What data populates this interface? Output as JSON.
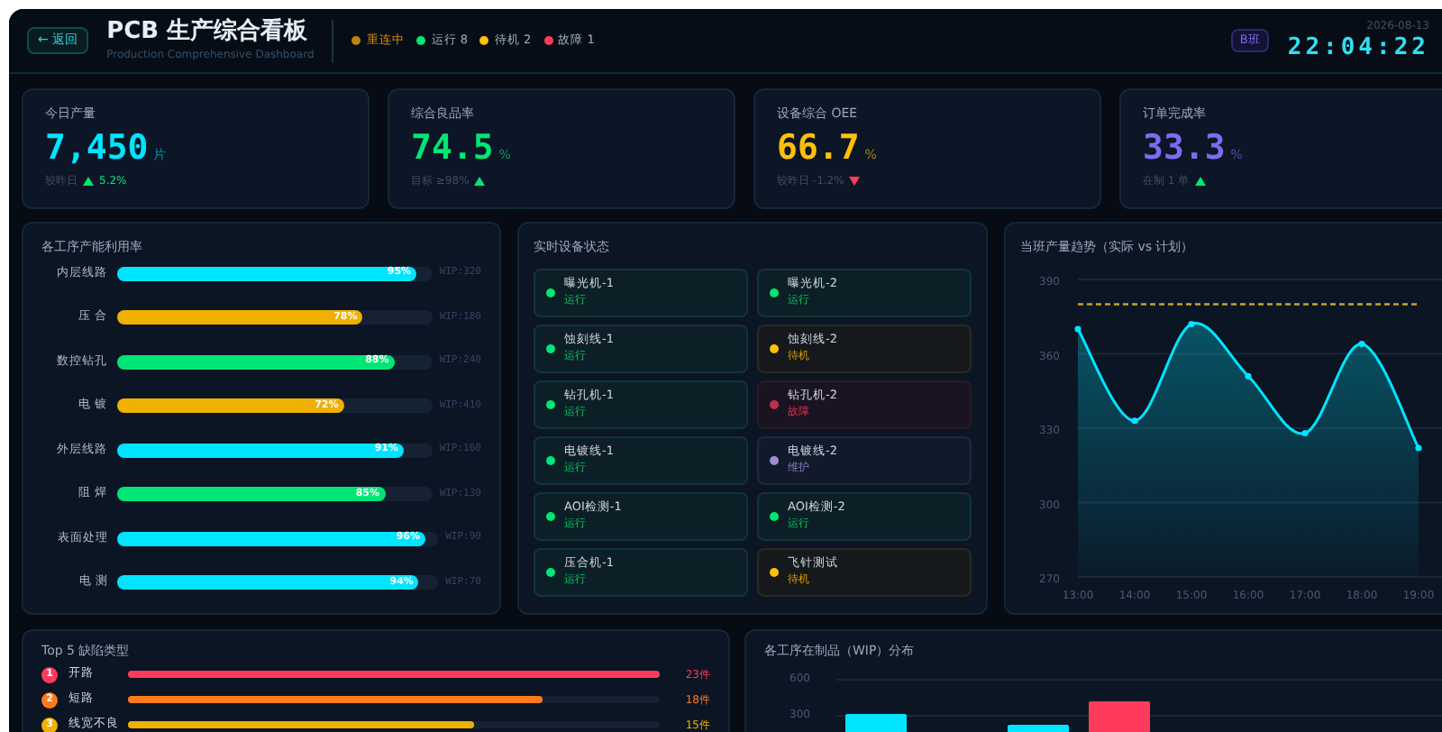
{
  "header": {
    "back": "← 返回",
    "title": "PCB 生产综合看板",
    "subtitle": "Production Comprehensive Dashboard",
    "statuses": [
      {
        "label": "重连中",
        "color": "#b8860b",
        "kind": "connection"
      },
      {
        "label": "运行 8",
        "color": "#00e676",
        "kind": "count"
      },
      {
        "label": "待机 2",
        "color": "#ffc107",
        "kind": "count"
      },
      {
        "label": "故障 1",
        "color": "#ff3b5c",
        "kind": "count"
      }
    ],
    "shift": "B班",
    "date": "2026-08-13",
    "time": "22:04:22"
  },
  "kpis": [
    {
      "label": "今日产量",
      "value": "7,450",
      "unit": "片",
      "color": "#00e5ff",
      "note": "较昨日",
      "trend_up": true,
      "change": "5.2%"
    },
    {
      "label": "综合良品率",
      "value": "74.5",
      "unit": "%",
      "color": "#00e676",
      "note": "目标 ≥98%",
      "trend_up": true
    },
    {
      "label": "设备综合 OEE",
      "value": "66.7",
      "unit": "%",
      "color": "#ffc107",
      "note": "较昨日 -1.2%",
      "trend_up": false
    },
    {
      "label": "订单完成率",
      "value": "33.3",
      "unit": "%",
      "color": "#7c6cf0",
      "note": "在制 1 单",
      "trend_up": true
    }
  ],
  "utilization": {
    "title": "各工序产能利用率",
    "rows": [
      {
        "name": "内层线路",
        "level": 0.95,
        "pct": "95%",
        "wip": "WIP:320",
        "color": "#00e5ff"
      },
      {
        "name": "压 合",
        "level": 0.78,
        "pct": "78%",
        "wip": "WIP:180",
        "color": "#f0b000"
      },
      {
        "name": "数控钻孔",
        "level": 0.88,
        "pct": "88%",
        "wip": "WIP:240",
        "color": "#00e676"
      },
      {
        "name": "电 镀",
        "level": 0.72,
        "pct": "72%",
        "wip": "WIP:410",
        "color": "#f0b000"
      },
      {
        "name": "外层线路",
        "level": 0.91,
        "pct": "91%",
        "wip": "WIP:160",
        "color": "#00e5ff"
      },
      {
        "name": "阻 焊",
        "level": 0.85,
        "pct": "85%",
        "wip": "WIP:130",
        "color": "#00e676"
      },
      {
        "name": "表面处理",
        "level": 0.96,
        "pct": "96%",
        "wip": "WIP:90",
        "color": "#00e5ff"
      },
      {
        "name": "电 测",
        "level": 0.94,
        "pct": "94%",
        "wip": "WIP:70",
        "color": "#00e5ff"
      }
    ]
  },
  "equipment": {
    "title": "实时设备状态",
    "items": [
      {
        "name": "曝光机-1",
        "status": "运行",
        "kind": "running"
      },
      {
        "name": "曝光机-2",
        "status": "运行",
        "kind": "running"
      },
      {
        "name": "蚀刻线-1",
        "status": "运行",
        "kind": "running"
      },
      {
        "name": "蚀刻线-2",
        "status": "待机",
        "kind": "idle"
      },
      {
        "name": "钻孔机-1",
        "status": "运行",
        "kind": "running"
      },
      {
        "name": "钻孔机-2",
        "status": "故障",
        "kind": "fault"
      },
      {
        "name": "电镀线-1",
        "status": "运行",
        "kind": "running"
      },
      {
        "name": "电镀线-2",
        "status": "维护",
        "kind": "maintenance"
      },
      {
        "name": "AOI检测-1",
        "status": "运行",
        "kind": "running"
      },
      {
        "name": "AOI检测-2",
        "status": "运行",
        "kind": "running"
      },
      {
        "name": "压合机-1",
        "status": "运行",
        "kind": "running"
      },
      {
        "name": "飞针测试",
        "status": "待机",
        "kind": "idle"
      }
    ]
  },
  "trend": {
    "title": "当班产量趋势（实际 vs 计划）",
    "chart_data": {
      "type": "area",
      "categories": [
        "13:00",
        "14:00",
        "15:00",
        "16:00",
        "17:00",
        "18:00",
        "19:00"
      ],
      "series": [
        {
          "color": "#00e5ff",
          "values": [
            370,
            333,
            372,
            351,
            328,
            364,
            322
          ]
        },
        {
          "type": "line",
          "line_style": "dashed",
          "color": "#c9a227",
          "values": [
            380,
            380,
            380,
            380,
            380,
            380,
            380
          ]
        }
      ],
      "grid": true,
      "ylim": [
        270,
        390
      ],
      "yticks": [
        270,
        300,
        330,
        360,
        390
      ]
    }
  },
  "defects": {
    "title": "Top 5 缺陷类型",
    "items": [
      {
        "rank": "1",
        "name": "开路",
        "level": 1,
        "count": "23件",
        "color": "#ff3b5c"
      },
      {
        "rank": "2",
        "name": "短路",
        "level": 0.78,
        "count": "18件",
        "color": "#ff7a1a"
      },
      {
        "rank": "3",
        "name": "线宽不良",
        "level": 0.65,
        "count": "15件",
        "color": "#f0b000"
      }
    ]
  },
  "wip": {
    "title": "各工序在制品（WIP）分布",
    "axis_labels": [
      "600",
      "300"
    ]
  }
}
